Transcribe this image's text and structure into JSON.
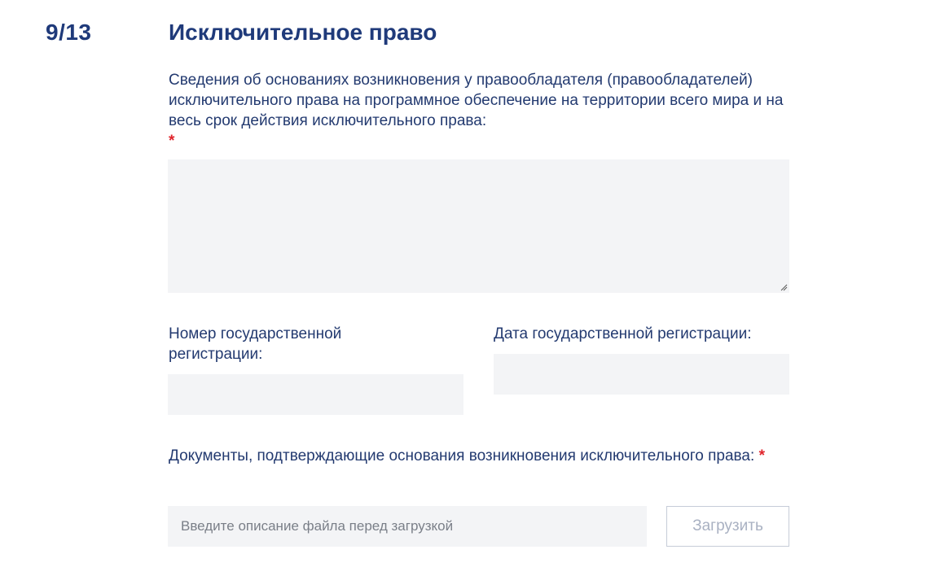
{
  "header": {
    "step_counter": "9/13",
    "title": "Исключительное право"
  },
  "form": {
    "basis_field": {
      "label": "Сведения об основаниях возникновения у правообладателя (правообладателей) исключительного права на программное обеспечение на территории всего мира и на весь срок действия исключительного права:",
      "required_marker": "*",
      "value": ""
    },
    "reg_number_field": {
      "label": "Номер государственной регистрации:",
      "value": ""
    },
    "reg_date_field": {
      "label": "Дата государственной регистрации:",
      "value": ""
    },
    "documents_field": {
      "label": "Документы, подтверждающие основания возникновения исключительного права:",
      "required_marker": "*",
      "placeholder": "Введите описание файла перед загрузкой"
    },
    "upload_button_label": "Загрузить"
  },
  "colors": {
    "heading": "#1f3a7a",
    "text": "#233a70",
    "required": "#e0242b",
    "field_bg": "#f3f4f6",
    "button_border": "#c6ccd8",
    "button_text": "#a9b1c2"
  },
  "icons": {
    "resize_handle": "resize-handle-icon"
  }
}
